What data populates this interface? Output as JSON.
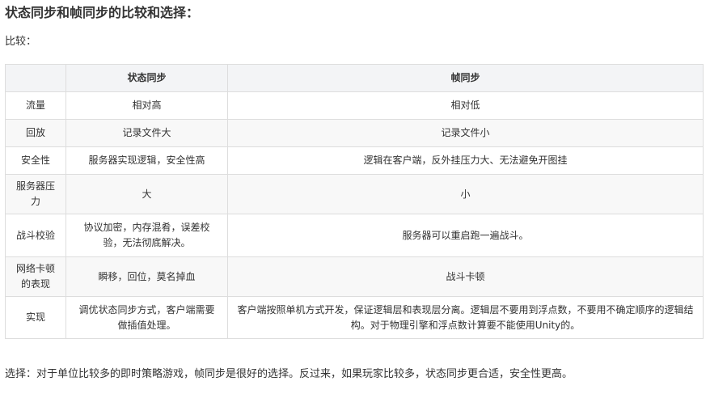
{
  "heading": "状态同步和帧同步的比较和选择：",
  "compare_label": "比较：",
  "table": {
    "headers": [
      "",
      "状态同步",
      "帧同步"
    ],
    "rows": [
      [
        "流量",
        "相对高",
        "相对低"
      ],
      [
        "回放",
        "记录文件大",
        "记录文件小"
      ],
      [
        "安全性",
        "服务器实现逻辑，安全性高",
        "逻辑在客户端，反外挂压力大、无法避免开图挂"
      ],
      [
        "服务器压力",
        "大",
        "小"
      ],
      [
        "战斗校验",
        "协议加密，内存混肴，误差校验，无法彻底解决。",
        "服务器可以重启跑一遍战斗。"
      ],
      [
        "网络卡顿的表现",
        "瞬移，回位，莫名掉血",
        "战斗卡顿"
      ],
      [
        "实现",
        "调优状态同步方式，客户端需要做插值处理。",
        "客户端按照单机方式开发，保证逻辑层和表现层分离。逻辑层不要用到浮点数，不要用不确定顺序的逻辑结构。对于物理引擎和浮点数计算要不能使用Unity的。"
      ]
    ]
  },
  "choice_text": "选择：对于单位比较多的即时策略游戏，帧同步是很好的选择。反过来，如果玩家比较多，状态同步更合适，安全性更高。"
}
